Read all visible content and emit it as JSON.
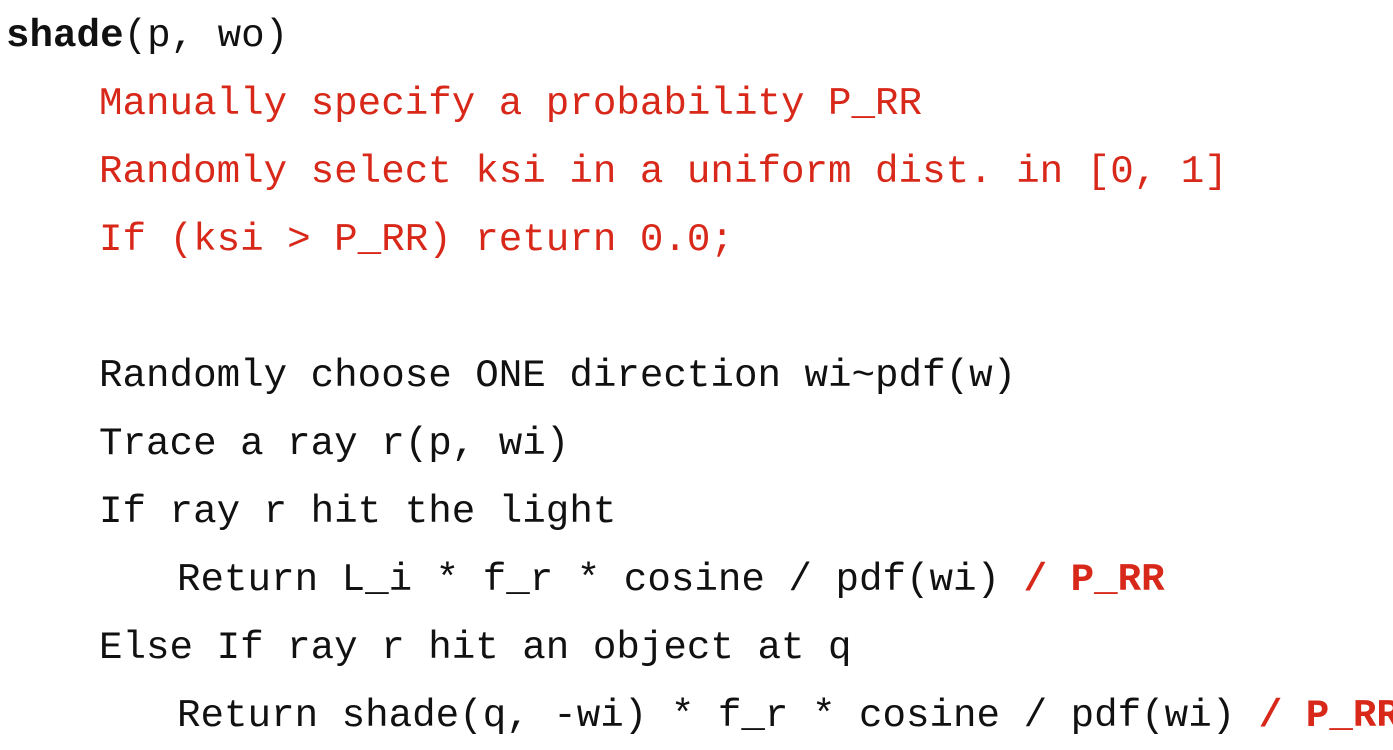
{
  "document": {
    "type": "pseudocode-slide",
    "background_color": "#ffffff",
    "accent_color": "#d8281a",
    "text_color": "#111111",
    "lines": [
      {
        "id": "line-signature",
        "indent": 0,
        "blank": false,
        "tokens": [
          {
            "text": "shade",
            "color": "#111111",
            "bold": true
          },
          {
            "text": "(p, wo)",
            "color": "#111111",
            "bold": false
          }
        ]
      },
      {
        "id": "line-specify-prr",
        "indent": 1,
        "blank": false,
        "tokens": [
          {
            "text": "Manually specify a probability P_RR",
            "color": "#d8281a",
            "bold": false
          }
        ]
      },
      {
        "id": "line-select-ksi",
        "indent": 1,
        "blank": false,
        "tokens": [
          {
            "text": "Randomly select ksi in a uniform dist. in [0, 1]",
            "color": "#d8281a",
            "bold": false
          }
        ]
      },
      {
        "id": "line-russian-roulette-test",
        "indent": 1,
        "blank": false,
        "tokens": [
          {
            "text": "If (ksi > P_RR) return 0.0;",
            "color": "#d8281a",
            "bold": false
          }
        ]
      },
      {
        "id": "line-blank-1",
        "indent": 0,
        "blank": true,
        "tokens": []
      },
      {
        "id": "line-choose-direction",
        "indent": 1,
        "blank": false,
        "tokens": [
          {
            "text": "Randomly choose ONE direction wi~pdf(w)",
            "color": "#111111",
            "bold": false
          }
        ]
      },
      {
        "id": "line-trace-ray",
        "indent": 1,
        "blank": false,
        "tokens": [
          {
            "text": "Trace a ray r(p, wi)",
            "color": "#111111",
            "bold": false
          }
        ]
      },
      {
        "id": "line-if-hit-light",
        "indent": 1,
        "blank": false,
        "tokens": [
          {
            "text": "If ray r hit the light",
            "color": "#111111",
            "bold": false
          }
        ]
      },
      {
        "id": "line-return-light",
        "indent": 2,
        "blank": false,
        "tokens": [
          {
            "text": "Return L_i * f_r * cosine / pdf(wi) ",
            "color": "#111111",
            "bold": false
          },
          {
            "text": "/ P_RR",
            "color": "#d8281a",
            "bold": true
          }
        ]
      },
      {
        "id": "line-else-if-hit-object",
        "indent": 1,
        "blank": false,
        "tokens": [
          {
            "text": "Else If ray r hit an object at q",
            "color": "#111111",
            "bold": false
          }
        ]
      },
      {
        "id": "line-return-shade",
        "indent": 2,
        "blank": false,
        "tokens": [
          {
            "text": "Return shade(q, -wi) * f_r * cosine / pdf(wi) ",
            "color": "#111111",
            "bold": false
          },
          {
            "text": "/ P_RR",
            "color": "#d8281a",
            "bold": true
          }
        ]
      }
    ]
  }
}
